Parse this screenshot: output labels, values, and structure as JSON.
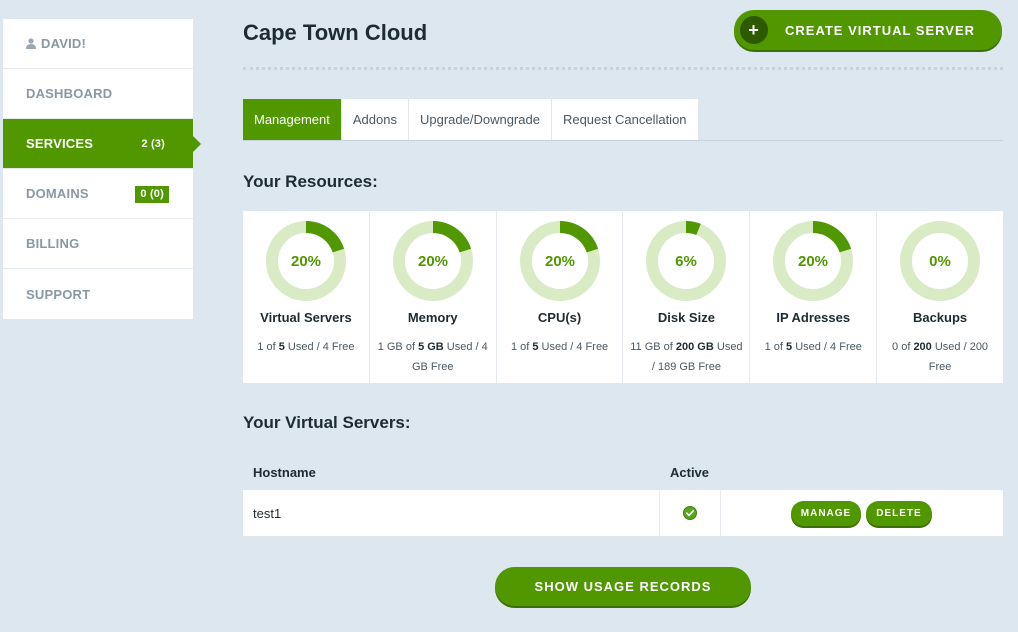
{
  "colors": {
    "accent": "#509700",
    "ring_bg": "#d8ebc4",
    "page_bg": "#dce7f0"
  },
  "sidebar": {
    "user_label": "DAVID!",
    "items": [
      {
        "label": "DASHBOARD",
        "count": ""
      },
      {
        "label": "SERVICES",
        "count": "2 (3)"
      },
      {
        "label": "DOMAINS",
        "count": "0 (0)"
      },
      {
        "label": "BILLING",
        "count": ""
      },
      {
        "label": "SUPPORT",
        "count": ""
      }
    ]
  },
  "header": {
    "title": "Cape Town Cloud",
    "create_button": "CREATE VIRTUAL SERVER",
    "create_icon": "plus-icon"
  },
  "tabs": [
    {
      "label": "Management"
    },
    {
      "label": "Addons"
    },
    {
      "label": "Upgrade/Downgrade"
    },
    {
      "label": "Request Cancellation"
    }
  ],
  "resources_title": "Your Resources:",
  "resources": [
    {
      "percent": 20,
      "percent_label": "20%",
      "label": "Virtual Servers",
      "detail_pre": "1 of ",
      "detail_bold": "5",
      "detail_post": " Used / 4 Free"
    },
    {
      "percent": 20,
      "percent_label": "20%",
      "label": "Memory",
      "detail_pre": "1 GB of ",
      "detail_bold": "5 GB",
      "detail_post": " Used / 4 GB Free"
    },
    {
      "percent": 20,
      "percent_label": "20%",
      "label": "CPU(s)",
      "detail_pre": "1 of ",
      "detail_bold": "5",
      "detail_post": " Used / 4 Free"
    },
    {
      "percent": 6,
      "percent_label": "6%",
      "label": "Disk Size",
      "detail_pre": "11 GB of ",
      "detail_bold": "200 GB",
      "detail_post": " Used / 189 GB Free"
    },
    {
      "percent": 20,
      "percent_label": "20%",
      "label": "IP Adresses",
      "detail_pre": "1 of ",
      "detail_bold": "5",
      "detail_post": " Used / 4 Free"
    },
    {
      "percent": 0,
      "percent_label": "0%",
      "label": "Backups",
      "detail_pre": "0 of ",
      "detail_bold": "200",
      "detail_post": " Used / 200 Free"
    }
  ],
  "servers_title": "Your Virtual Servers:",
  "servers_table": {
    "headers": {
      "hostname": "Hostname",
      "active": "Active"
    },
    "rows": [
      {
        "hostname": "test1",
        "active_icon": "check-circle-icon",
        "manage_label": "MANAGE",
        "delete_label": "DELETE"
      }
    ]
  },
  "usage_button": "SHOW USAGE RECORDS"
}
